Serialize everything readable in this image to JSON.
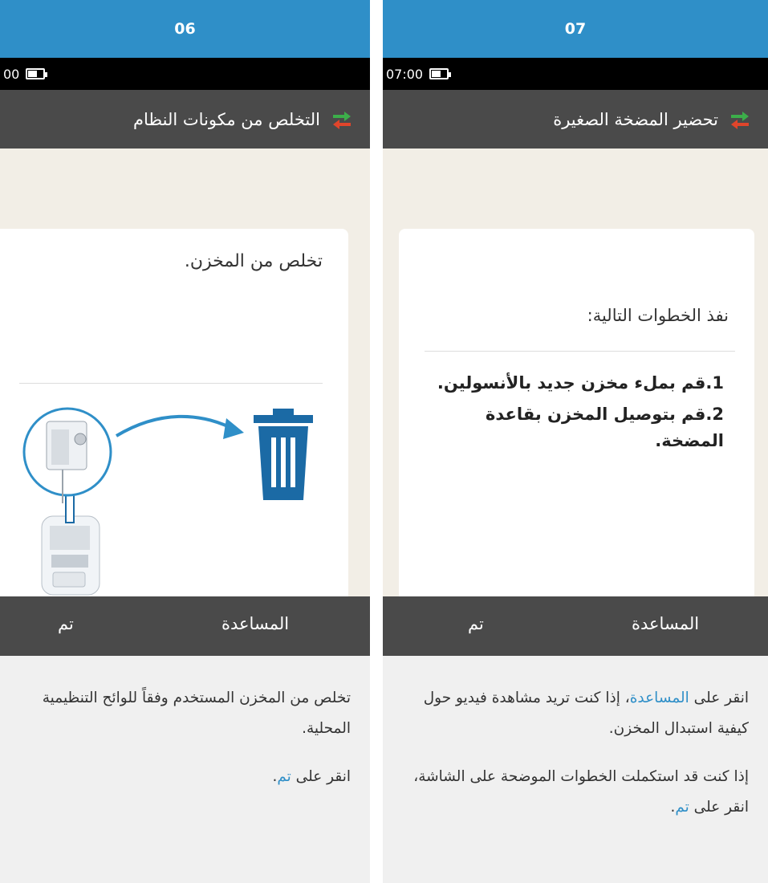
{
  "panels": [
    {
      "step_number": "06",
      "status_time": "00",
      "screen_title": "التخلص من مكونات النظام",
      "card_text": "تخلص من المخزن.",
      "footer": {
        "help_label": "المساعدة",
        "done_label": "تم"
      },
      "notes": {
        "paragraph_1": "تخلص من المخزن المستخدم وفقاً للوائح التنظيمية المحلية.",
        "paragraph_2_prefix": "انقر على ",
        "paragraph_2_link": "تم",
        "paragraph_2_suffix": "."
      }
    },
    {
      "step_number": "07",
      "status_time": "07:00",
      "screen_title": "تحضير المضخة الصغيرة",
      "card_heading": "نفذ الخطوات التالية:",
      "steps": [
        "1.قم بملء مخزن جديد بالأنسولين.",
        "2.قم بتوصيل المخزن بقاعدة المضخة."
      ],
      "footer": {
        "help_label": "المساعدة",
        "done_label": "تم"
      },
      "notes": {
        "paragraph_1_prefix": "انقر على ",
        "paragraph_1_link": "المساعدة",
        "paragraph_1_suffix": "، إذا كنت تريد مشاهدة فيديو حول كيفية استبدال المخزن.",
        "paragraph_2_prefix": "إذا كنت قد استكملت الخطوات الموضحة على الشاشة، انقر على ",
        "paragraph_2_link": "تم",
        "paragraph_2_suffix": "."
      }
    }
  ],
  "icons": {
    "swap": "swap-arrows-icon",
    "battery": "battery-icon",
    "trash": "trash-can-icon"
  },
  "colors": {
    "header_blue": "#2f8fc8",
    "bar_gray": "#4a4a4a",
    "arrow_green": "#3cae4a",
    "arrow_red": "#e0452b",
    "trash_blue": "#1b6aa5",
    "link_blue": "#2f8fc8"
  }
}
